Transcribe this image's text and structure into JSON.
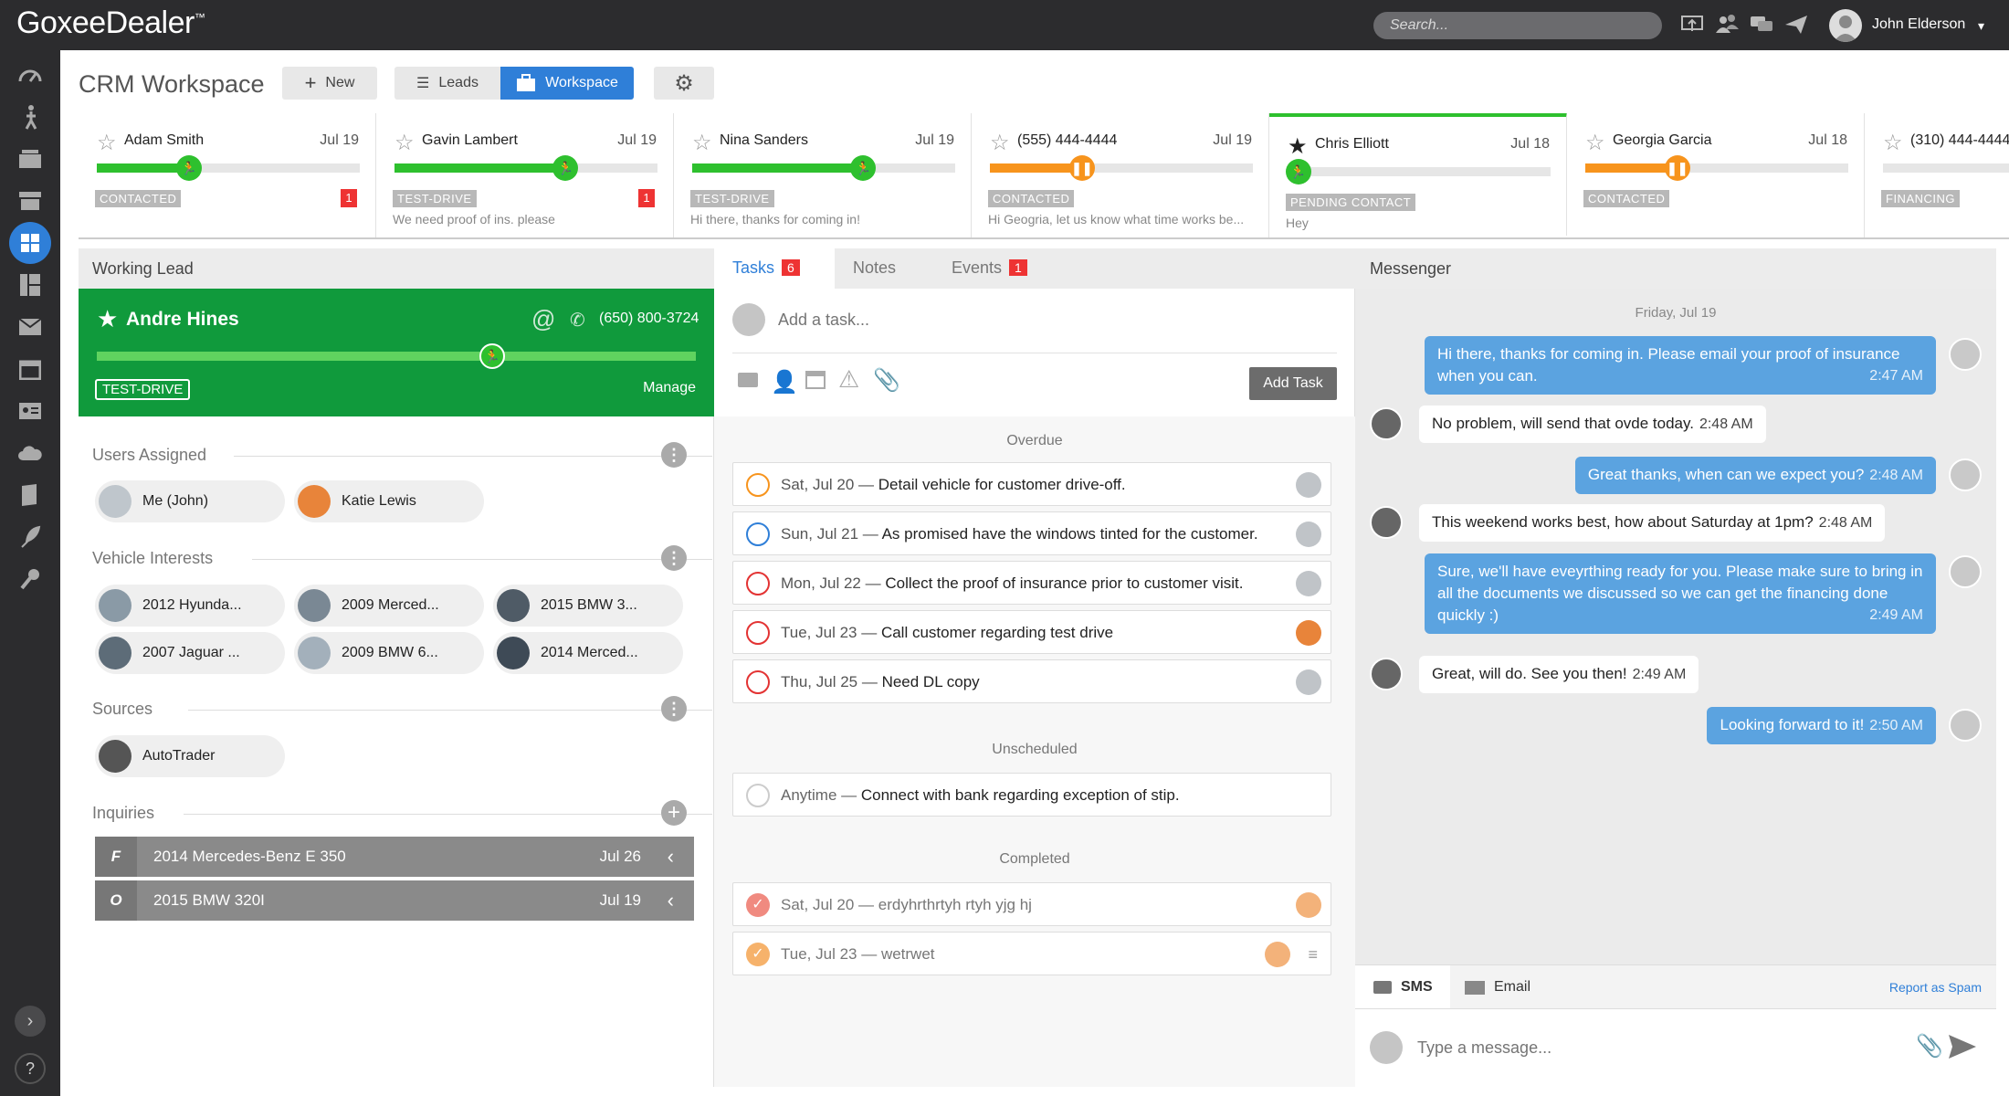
{
  "app": {
    "brand": "GoxeeDealer",
    "tm": "™"
  },
  "topbar": {
    "search_placeholder": "Search...",
    "user_name": "John Elderson"
  },
  "header": {
    "title": "CRM Workspace",
    "new_label": "New",
    "leads_label": "Leads",
    "workspace_label": "Workspace"
  },
  "colors": {
    "green": "#2ec02e",
    "orange": "#f7941d",
    "blue": "#2f7fd8",
    "red": "#e33333"
  },
  "lead_cards": [
    {
      "name": "Adam Smith",
      "date": "Jul 19",
      "status": "CONTACTED",
      "badge": "1",
      "snippet": "",
      "progress": 0.35,
      "color": "green",
      "starred": false
    },
    {
      "name": "Gavin Lambert",
      "date": "Jul 19",
      "status": "TEST-DRIVE",
      "badge": "1",
      "snippet": "We need proof of ins. please",
      "progress": 0.65,
      "color": "green",
      "starred": false
    },
    {
      "name": "Nina Sanders",
      "date": "Jul 19",
      "status": "TEST-DRIVE",
      "badge": "",
      "snippet": "Hi there, thanks for coming in!",
      "progress": 0.65,
      "color": "green",
      "starred": false
    },
    {
      "name": "(555) 444-4444",
      "date": "Jul 19",
      "status": "CONTACTED",
      "badge": "",
      "snippet": "Hi Geogria, let us know what time works be...",
      "progress": 0.35,
      "color": "orange",
      "starred": false
    },
    {
      "name": "Chris Elliott",
      "date": "Jul 18",
      "status": "PENDING CONTACT",
      "badge": "",
      "snippet": "Hey",
      "progress": 0.04,
      "color": "green",
      "starred": true
    },
    {
      "name": "Georgia Garcia",
      "date": "Jul 18",
      "status": "CONTACTED",
      "badge": "",
      "snippet": "",
      "progress": 0.35,
      "color": "orange",
      "starred": false
    },
    {
      "name": "(310) 444-4444",
      "date": "",
      "status": "FINANCING",
      "badge": "",
      "snippet": "",
      "progress": 0,
      "color": "green",
      "starred": false
    }
  ],
  "working_lead": {
    "header": "Working Lead",
    "name": "Andre Hines",
    "phone": "(650) 800-3724",
    "status": "TEST-DRIVE",
    "manage": "Manage",
    "progress": 0.66,
    "users_assigned_label": "Users Assigned",
    "users": [
      "Me (John)",
      "Katie Lewis"
    ],
    "vehicle_interests_label": "Vehicle Interests",
    "vehicles": [
      "2012 Hyunda...",
      "2009 Merced...",
      "2015 BMW 3...",
      "2007 Jaguar ...",
      "2009 BMW 6...",
      "2014 Merced..."
    ],
    "sources_label": "Sources",
    "sources": [
      "AutoTrader"
    ],
    "inquiries_label": "Inquiries",
    "inquiries": [
      {
        "letter": "F",
        "vehicle": "2014 Mercedes-Benz E 350",
        "date": "Jul 26"
      },
      {
        "letter": "O",
        "vehicle": "2015 BMW 320I",
        "date": "Jul 19"
      }
    ]
  },
  "tasks": {
    "tab_tasks": "Tasks",
    "tasks_count": "6",
    "tab_notes": "Notes",
    "tab_events": "Events",
    "events_count": "1",
    "add_placeholder": "Add a task...",
    "add_button": "Add Task",
    "overdue_label": "Overdue",
    "overdue": [
      {
        "date": "Sat, Jul 20",
        "text": "Detail vehicle for customer drive-off.",
        "ring": "#f7941d"
      },
      {
        "date": "Sun, Jul 21",
        "text": "As promised have the windows tinted for the customer.",
        "ring": "#2f7fd8"
      },
      {
        "date": "Mon, Jul 22",
        "text": "Collect the proof of insurance prior to customer visit.",
        "ring": "#e33333"
      },
      {
        "date": "Tue, Jul 23",
        "text": "Call customer regarding test drive",
        "ring": "#e33333"
      },
      {
        "date": "Thu, Jul 25",
        "text": "Need DL copy",
        "ring": "#e33333"
      }
    ],
    "unscheduled_label": "Unscheduled",
    "unscheduled": [
      {
        "date": "Anytime",
        "text": "Connect with bank regarding exception of stip."
      }
    ],
    "completed_label": "Completed",
    "completed": [
      {
        "date": "Sat, Jul 20",
        "text": "erdyhrthrtyh rtyh yjg hj"
      },
      {
        "date": "Tue, Jul 23",
        "text": "wetrwet"
      }
    ]
  },
  "messenger": {
    "header": "Messenger",
    "day": "Friday, Jul 19",
    "messages": [
      {
        "dir": "out",
        "text": "Hi there, thanks for coming in. Please email your proof of insurance when you can.",
        "time": "2:47 AM"
      },
      {
        "dir": "in",
        "text": "No problem, will send that ovde today.",
        "time": "2:48 AM"
      },
      {
        "dir": "out",
        "text": "Great thanks, when can we expect you?",
        "time": "2:48 AM"
      },
      {
        "dir": "in",
        "text": "This weekend works best, how about Saturday at 1pm?",
        "time": "2:48 AM"
      },
      {
        "dir": "out",
        "text": "Sure, we'll have eveyrthing ready for you. Please make sure to bring in all the documents we discussed so we can get the financing done quickly :)",
        "time": "2:49 AM"
      },
      {
        "dir": "in",
        "text": "Great, will do. See you then!",
        "time": "2:49 AM"
      },
      {
        "dir": "out",
        "text": "Looking forward to it!",
        "time": "2:50 AM"
      }
    ],
    "tab_sms": "SMS",
    "tab_email": "Email",
    "report_spam": "Report as Spam",
    "input_placeholder": "Type a message..."
  }
}
